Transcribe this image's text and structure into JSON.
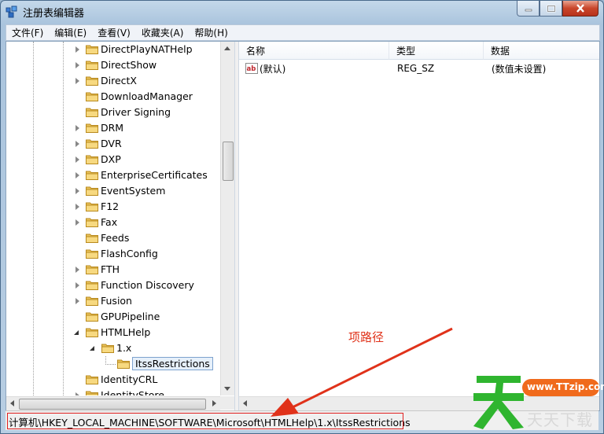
{
  "window": {
    "title": "注册表编辑器"
  },
  "menu": [
    "文件(F)",
    "编辑(E)",
    "查看(V)",
    "收藏夹(A)",
    "帮助(H)"
  ],
  "tree": {
    "items": [
      {
        "label": "DirectPlayNATHelp",
        "expandable": true
      },
      {
        "label": "DirectShow",
        "expandable": true
      },
      {
        "label": "DirectX",
        "expandable": true
      },
      {
        "label": "DownloadManager",
        "expandable": false
      },
      {
        "label": "Driver Signing",
        "expandable": false
      },
      {
        "label": "DRM",
        "expandable": true
      },
      {
        "label": "DVR",
        "expandable": true
      },
      {
        "label": "DXP",
        "expandable": true
      },
      {
        "label": "EnterpriseCertificates",
        "expandable": true
      },
      {
        "label": "EventSystem",
        "expandable": true
      },
      {
        "label": "F12",
        "expandable": true
      },
      {
        "label": "Fax",
        "expandable": true
      },
      {
        "label": "Feeds",
        "expandable": false
      },
      {
        "label": "FlashConfig",
        "expandable": false
      },
      {
        "label": "FTH",
        "expandable": true
      },
      {
        "label": "Function Discovery",
        "expandable": true
      },
      {
        "label": "Fusion",
        "expandable": true
      },
      {
        "label": "GPUPipeline",
        "expandable": false
      },
      {
        "label": "HTMLHelp",
        "expandable": true,
        "expanded": true
      },
      {
        "label": "1.x",
        "expandable": true,
        "expanded": true,
        "level": 2
      },
      {
        "label": "ItssRestrictions",
        "expandable": false,
        "level": 3,
        "selected": true
      },
      {
        "label": "IdentityCRL",
        "expandable": false
      },
      {
        "label": "IdentityStore",
        "expandable": true
      }
    ]
  },
  "list": {
    "headers": {
      "name": "名称",
      "type": "类型",
      "data": "数据"
    },
    "rows": [
      {
        "icon": "string-value-icon",
        "name": "(默认)",
        "type": "REG_SZ",
        "data": "(数值未设置)"
      }
    ]
  },
  "status": {
    "path": "计算机\\HKEY_LOCAL_MACHINE\\SOFTWARE\\Microsoft\\HTMLHelp\\1.x\\ItssRestrictions"
  },
  "annotation": {
    "label": "项路径"
  },
  "watermark": {
    "url": "www.TTzip.com",
    "brand": "天天下载"
  },
  "colors": {
    "annotation": "#e0321a",
    "watermark_green": "#2fb52f",
    "watermark_orange": "#f06a1c"
  }
}
